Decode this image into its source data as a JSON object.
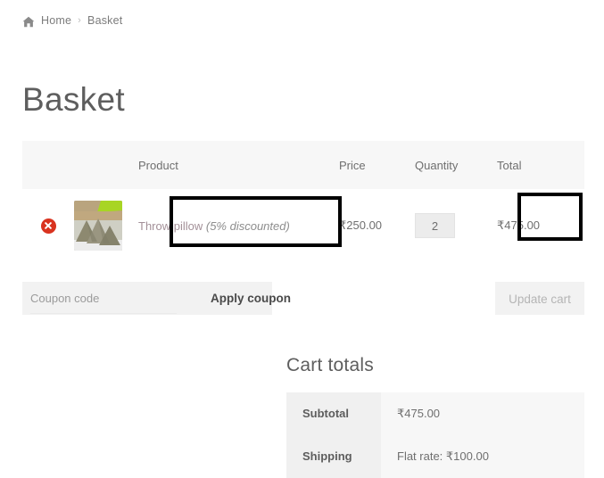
{
  "breadcrumb": {
    "home_icon": "home-icon",
    "home_label": "Home",
    "separator": "›",
    "current_label": "Basket"
  },
  "page": {
    "title": "Basket"
  },
  "cart_table": {
    "headers": {
      "remove": "",
      "thumbnail": "",
      "product": "Product",
      "price": "Price",
      "quantity": "Quantity",
      "total": "Total"
    },
    "rows": [
      {
        "remove_icon": "remove-circle-icon",
        "thumbnail_alt": "throw-pillow-thumbnail",
        "product_name": "Throw pillow",
        "product_note": "(5% discounted)",
        "price": "₹250.00",
        "quantity": "2",
        "total": "₹475.00"
      }
    ]
  },
  "coupon": {
    "placeholder": "Coupon code",
    "value": "",
    "apply_label": "Apply coupon",
    "update_cart_label": "Update cart"
  },
  "cart_totals": {
    "title": "Cart totals",
    "rows": [
      {
        "label": "Subtotal",
        "value": "₹475.00"
      },
      {
        "label": "Shipping",
        "value": "Flat rate: ₹100.00"
      }
    ]
  },
  "colors": {
    "remove_red": "#d9331f",
    "header_bg": "#f7f7f7",
    "annotation": "#000000",
    "product_link": "#a39098"
  }
}
